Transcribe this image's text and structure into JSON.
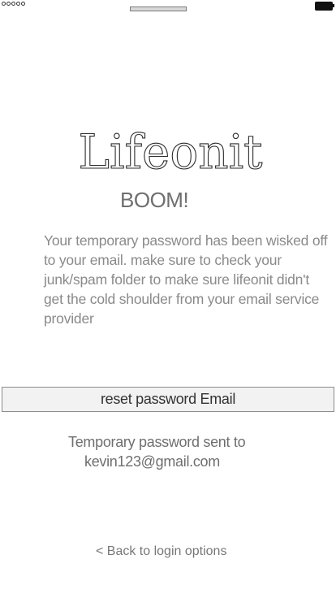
{
  "status_bar": {
    "signal_icon": "signal-dots-icon",
    "battery_icon": "battery-icon"
  },
  "logo": {
    "text": "Lifeonit"
  },
  "heading": "BOOM!",
  "message": "Your temporary password has been wisked off to your email. make sure to check your junk/spam folder to make sure lifeonit didn't get the cold shoulder from your email service provider",
  "reset_button": {
    "label": "reset password Email"
  },
  "sent_notice": {
    "line1": "Temporary password sent to",
    "email": "kevin123@gmail.com"
  },
  "back_link": {
    "label": "< Back to login options"
  },
  "colors": {
    "text_primary": "#333333",
    "text_muted": "#8a8a8a",
    "button_bg": "#f2f2f2",
    "button_border": "#8c8c8c"
  }
}
